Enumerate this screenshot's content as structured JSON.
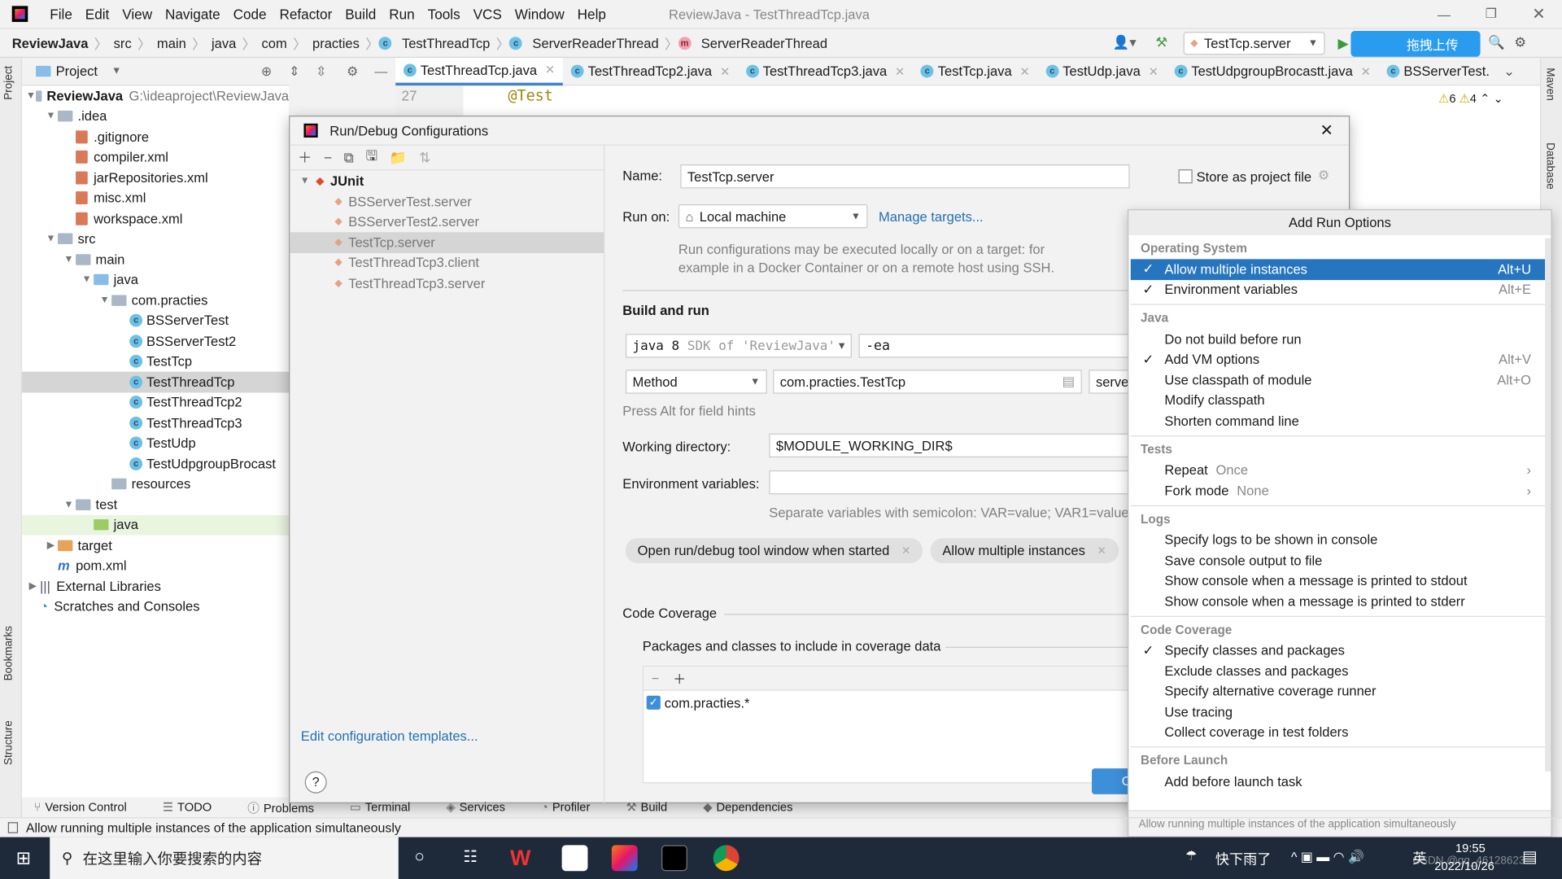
{
  "window": {
    "title": "ReviewJava - TestThreadTcp.java",
    "menu": [
      "File",
      "Edit",
      "View",
      "Navigate",
      "Code",
      "Refactor",
      "Build",
      "Run",
      "Tools",
      "VCS",
      "Window",
      "Help"
    ]
  },
  "breadcrumb": [
    "ReviewJava",
    "src",
    "main",
    "java",
    "com",
    "practies",
    "TestThreadTcp",
    "ServerReaderThread",
    "ServerReaderThread"
  ],
  "toolbar": {
    "run_config": "TestTcp.server",
    "upload_label": "拖拽上传"
  },
  "left_strip": [
    "Project",
    "Bookmarks",
    "Structure"
  ],
  "right_strip": [
    "Maven",
    "Database"
  ],
  "project": {
    "title": "Project",
    "root_name": "ReviewJava",
    "root_path": "G:\\ideaproject\\ReviewJava",
    "tree": [
      {
        "label": ".idea",
        "level": 1,
        "kind": "folder",
        "open": true
      },
      {
        "label": ".gitignore",
        "level": 2,
        "kind": "file"
      },
      {
        "label": "compiler.xml",
        "level": 2,
        "kind": "file"
      },
      {
        "label": "jarRepositories.xml",
        "level": 2,
        "kind": "file"
      },
      {
        "label": "misc.xml",
        "level": 2,
        "kind": "file"
      },
      {
        "label": "workspace.xml",
        "level": 2,
        "kind": "file"
      },
      {
        "label": "src",
        "level": 1,
        "kind": "folder",
        "open": true
      },
      {
        "label": "main",
        "level": 2,
        "kind": "folder",
        "open": true
      },
      {
        "label": "java",
        "level": 3,
        "kind": "folder-blue",
        "open": true
      },
      {
        "label": "com.practies",
        "level": 4,
        "kind": "folder",
        "open": true
      },
      {
        "label": "BSServerTest",
        "level": 5,
        "kind": "class"
      },
      {
        "label": "BSServerTest2",
        "level": 5,
        "kind": "class"
      },
      {
        "label": "TestTcp",
        "level": 5,
        "kind": "class"
      },
      {
        "label": "TestThreadTcp",
        "level": 5,
        "kind": "class",
        "selected": true
      },
      {
        "label": "TestThreadTcp2",
        "level": 5,
        "kind": "class"
      },
      {
        "label": "TestThreadTcp3",
        "level": 5,
        "kind": "class"
      },
      {
        "label": "TestUdp",
        "level": 5,
        "kind": "class"
      },
      {
        "label": "TestUdpgroupBrocast",
        "level": 5,
        "kind": "class"
      },
      {
        "label": "resources",
        "level": 4,
        "kind": "folder"
      },
      {
        "label": "test",
        "level": 2,
        "kind": "folder",
        "open": true
      },
      {
        "label": "java",
        "level": 3,
        "kind": "folder-green",
        "highlight": true
      },
      {
        "label": "target",
        "level": 1,
        "kind": "folder-orange",
        "open": false
      },
      {
        "label": "pom.xml",
        "level": 1,
        "kind": "maven"
      },
      {
        "label": "External Libraries",
        "level": 0,
        "kind": "lib",
        "open": false
      },
      {
        "label": "Scratches and Consoles",
        "level": 0,
        "kind": "scratch"
      }
    ]
  },
  "editor": {
    "tabs": [
      "TestThreadTcp.java",
      "TestThreadTcp2.java",
      "TestThreadTcp3.java",
      "TestTcp.java",
      "TestUdp.java",
      "TestUdpgroupBrocastt.java",
      "BSServerTest."
    ],
    "line_number": "27",
    "code": "@Test",
    "warnings": "6",
    "weak_warnings": "4"
  },
  "dialog": {
    "title": "Run/Debug Configurations",
    "group": "JUnit",
    "configs": [
      "BSServerTest.server",
      "BSServerTest2.server",
      "TestTcp.server",
      "TestThreadTcp3.client",
      "TestThreadTcp3.server"
    ],
    "edit_templates": "Edit configuration templates...",
    "name_label": "Name:",
    "name_value": "TestTcp.server",
    "store_label": "Store as project file",
    "run_on_label": "Run on:",
    "run_on_value": "Local machine",
    "manage_targets": "Manage targets...",
    "run_on_hint": "Run configurations may be executed locally or on a target: for example in a Docker Container or on a remote host using SSH.",
    "build_run": "Build and run",
    "jdk_main": "java 8",
    "jdk_sub": "SDK of 'ReviewJava'",
    "vm_options": "-ea",
    "test_kind": "Method",
    "class_value": "com.practies.TestTcp",
    "method_value": "server",
    "field_hint": "Press Alt for field hints",
    "workdir_label": "Working directory:",
    "workdir_value": "$MODULE_WORKING_DIR$",
    "env_label": "Environment variables:",
    "env_value": "",
    "env_hint": "Separate variables with semicolon: VAR=value; VAR1=value1",
    "chips": [
      "Open run/debug tool window when started",
      "Allow multiple instances"
    ],
    "coverage_title": "Code Coverage",
    "coverage_sub": "Packages and classes to include in coverage data",
    "coverage_item": "com.practies.*",
    "ok_label": "O"
  },
  "popup": {
    "title": "Add Run Options",
    "footer": "Allow running multiple instances of the application simultaneously",
    "groups": [
      {
        "title": "Operating System",
        "items": [
          {
            "label": "Allow multiple instances",
            "checked": true,
            "shortcut": "Alt+U",
            "selected": true
          },
          {
            "label": "Environment variables",
            "checked": true,
            "shortcut": "Alt+E"
          }
        ]
      },
      {
        "title": "Java",
        "items": [
          {
            "label": "Do not build before run"
          },
          {
            "label": "Add VM options",
            "checked": true,
            "shortcut": "Alt+V"
          },
          {
            "label": "Use classpath of module",
            "shortcut": "Alt+O"
          },
          {
            "label": "Modify classpath"
          },
          {
            "label": "Shorten command line"
          }
        ]
      },
      {
        "title": "Tests",
        "items": [
          {
            "label": "Repeat",
            "sub": "Once",
            "submenu": true
          },
          {
            "label": "Fork mode",
            "sub": "None",
            "submenu": true
          }
        ]
      },
      {
        "title": "Logs",
        "items": [
          {
            "label": "Specify logs to be shown in console"
          },
          {
            "label": "Save console output to file"
          },
          {
            "label": "Show console when a message is printed to stdout"
          },
          {
            "label": "Show console when a message is printed to stderr"
          }
        ]
      },
      {
        "title": "Code Coverage",
        "items": [
          {
            "label": "Specify classes and packages",
            "checked": true
          },
          {
            "label": "Exclude classes and packages"
          },
          {
            "label": "Specify alternative coverage runner"
          },
          {
            "label": "Use tracing"
          },
          {
            "label": "Collect coverage in test folders"
          }
        ]
      },
      {
        "title": "Before Launch",
        "items": [
          {
            "label": "Add before launch task"
          }
        ]
      }
    ]
  },
  "bottom_tabs": [
    "Version Control",
    "TODO",
    "Problems",
    "Terminal",
    "Services",
    "Profiler",
    "Build",
    "Dependencies"
  ],
  "status_text": "Allow running multiple instances of the application simultaneously",
  "taskbar": {
    "search_placeholder": "在这里输入你要搜索的内容",
    "weather": "快下雨了",
    "ime": "英",
    "time": "19:55",
    "date": "2022/10/26",
    "watermark": "CSDN @qq_46128623"
  },
  "colors": {
    "accent": "#2675bf",
    "link": "#2470b3",
    "taskbar": "#1e2a3a"
  }
}
